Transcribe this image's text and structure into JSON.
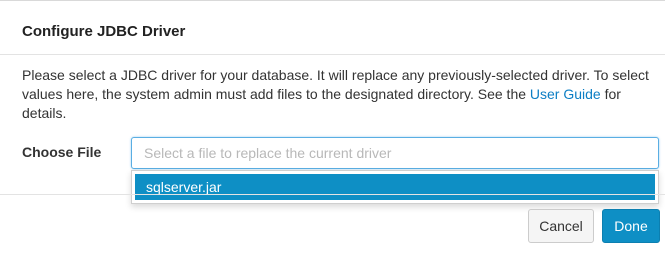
{
  "dialog": {
    "title": "Configure JDBC Driver",
    "description_before_link": "Please select a JDBC driver for your database. It will replace any previously-selected driver. To select values here, the system admin must add files to the designated directory. See the ",
    "link_text": "User Guide",
    "description_after_link": " for details."
  },
  "form": {
    "field_label": "Choose File",
    "placeholder": "Select a file to replace the current driver",
    "options": [
      "sqlserver.jar"
    ]
  },
  "buttons": {
    "cancel_label": "Cancel",
    "done_label": "Done"
  },
  "colors": {
    "accent": "#0e8fc5",
    "link": "#0c7ec4"
  }
}
